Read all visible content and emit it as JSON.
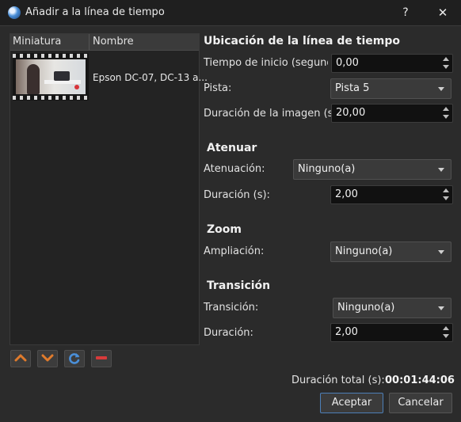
{
  "window": {
    "title": "Añadir a la línea de tiempo",
    "help_label": "?",
    "close_label": "✕"
  },
  "file_list": {
    "columns": [
      "Miniatura",
      "Nombre"
    ],
    "items": [
      {
        "name": "Epson DC-07, DC-13 a..."
      }
    ],
    "buttons": [
      {
        "icon": "arrow-up-icon",
        "color": "#e07b2c"
      },
      {
        "icon": "arrow-down-icon",
        "color": "#e07b2c"
      },
      {
        "icon": "refresh-icon",
        "color": "#4a8fd8"
      },
      {
        "icon": "remove-icon",
        "color": "#d83a3a"
      }
    ]
  },
  "position": {
    "heading": "Ubicación de la línea de tiempo",
    "start_label": "Tiempo de inicio (segundos)",
    "start_value": "0,00",
    "track_label": "Pista:",
    "track_value": "Pista 5",
    "image_duration_label": "Duración de la imagen (s)",
    "image_duration_value": "20,00"
  },
  "fade": {
    "heading": "Atenuar",
    "fade_label": "Atenuación:",
    "fade_value": "Ninguno(a)",
    "duration_label": "Duración (s):",
    "duration_value": "2,00"
  },
  "zoom": {
    "heading": "Zoom",
    "zoom_label": "Ampliación:",
    "zoom_value": "Ninguno(a)"
  },
  "transition": {
    "heading": "Transición",
    "transition_label": "Transición:",
    "transition_value": "Ninguno(a)",
    "duration_label": "Duración:",
    "duration_value": "2,00"
  },
  "footer": {
    "total_label": "Duración total (s):",
    "total_value": "00:01:44:06",
    "ok_label": "Aceptar",
    "cancel_label": "Cancelar"
  },
  "colors": {
    "background": "#2b2b2b",
    "accent": "#4d7fb8"
  }
}
